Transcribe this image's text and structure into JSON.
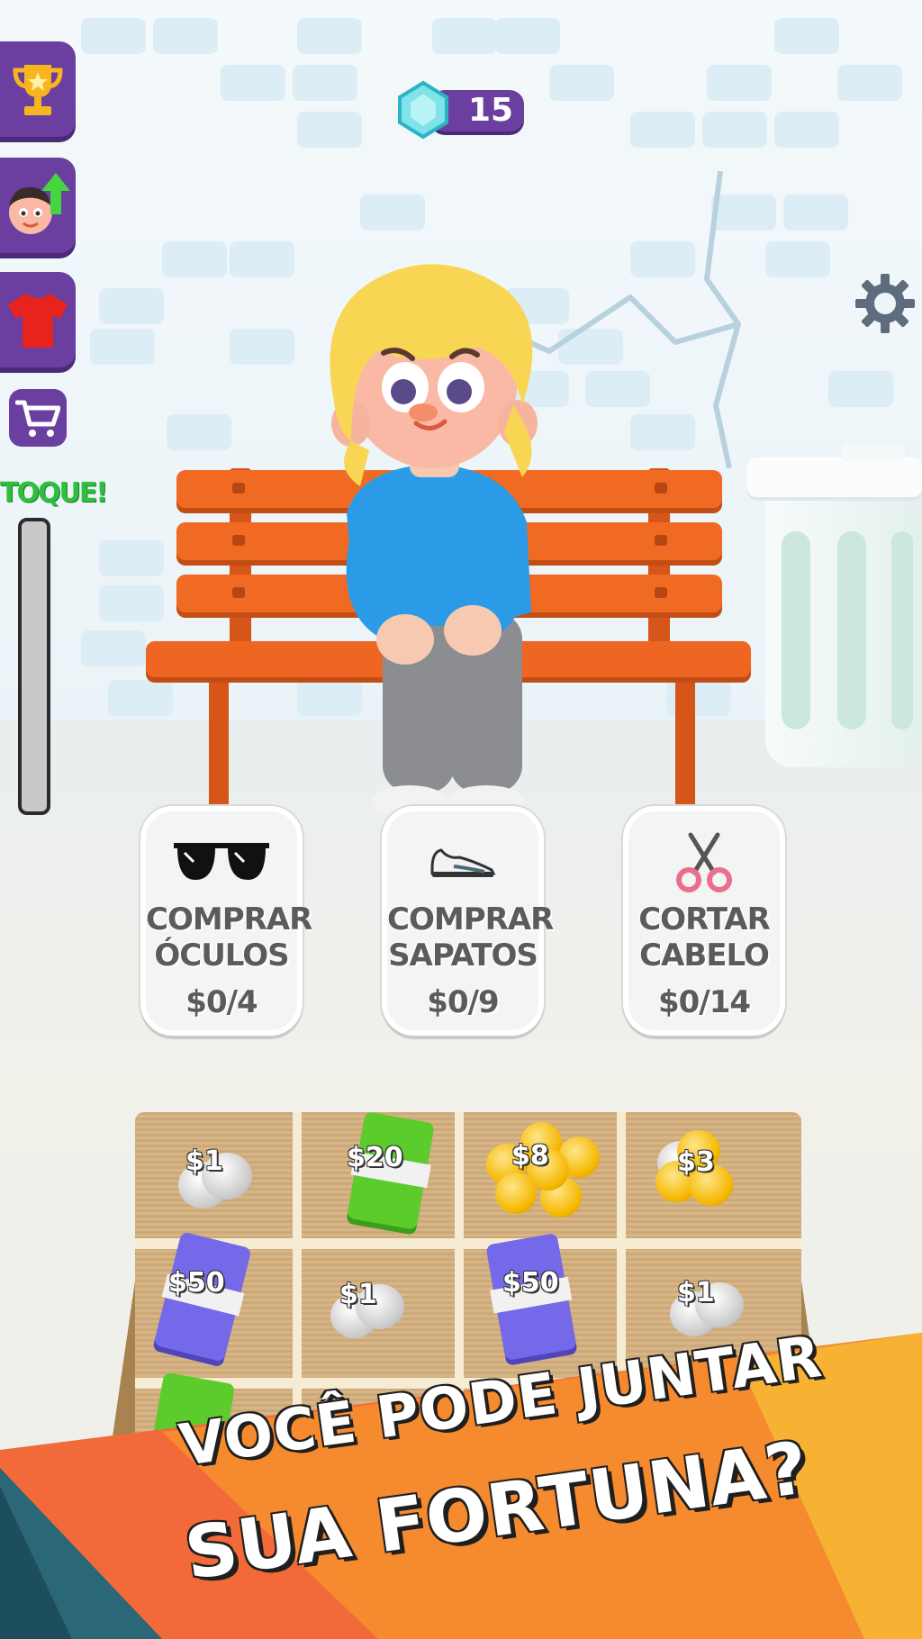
{
  "hud": {
    "gem_count": "15",
    "gem_icon": "diamond-gem-icon",
    "settings_icon": "gear-icon"
  },
  "sidebar": {
    "items": [
      {
        "name": "trophy-icon"
      },
      {
        "name": "character-upgrade-icon"
      },
      {
        "name": "shirt-icon"
      },
      {
        "name": "cart-icon"
      }
    ],
    "tap_label": "TOQUE!",
    "tap_meter_fraction": 0
  },
  "actions": [
    {
      "line1": "COMPRAR",
      "line2": "ÓCULOS",
      "price": "$0/4",
      "icon": "sunglasses-icon"
    },
    {
      "line1": "COMPRAR",
      "line2": "SAPATOS",
      "price": "$0/9",
      "icon": "sneaker-icon"
    },
    {
      "line1": "CORTAR",
      "line2": "CABELO",
      "price": "$0/14",
      "icon": "scissors-icon"
    }
  ],
  "tray": {
    "cells": [
      {
        "label": "$1",
        "kind": "silver-coins"
      },
      {
        "label": "$20",
        "kind": "green-bills"
      },
      {
        "label": "$8",
        "kind": "gold-coins"
      },
      {
        "label": "$3",
        "kind": "mixed-coins"
      },
      {
        "label": "$50",
        "kind": "purple-bills"
      },
      {
        "label": "$1",
        "kind": "silver-coins"
      },
      {
        "label": "$50",
        "kind": "purple-bills"
      },
      {
        "label": "$1",
        "kind": "silver-coins"
      }
    ]
  },
  "banner": {
    "line1": "VOCÊ PODE JUNTAR",
    "line2": "SUA FORTUNA?"
  },
  "colors": {
    "sidebar_purple": "#6a3fa0",
    "bench_orange": "#f06a24",
    "banner_orange": "#f58a2e",
    "banner_teal": "#1c4e5e",
    "tap_green": "#2fbf3f"
  }
}
